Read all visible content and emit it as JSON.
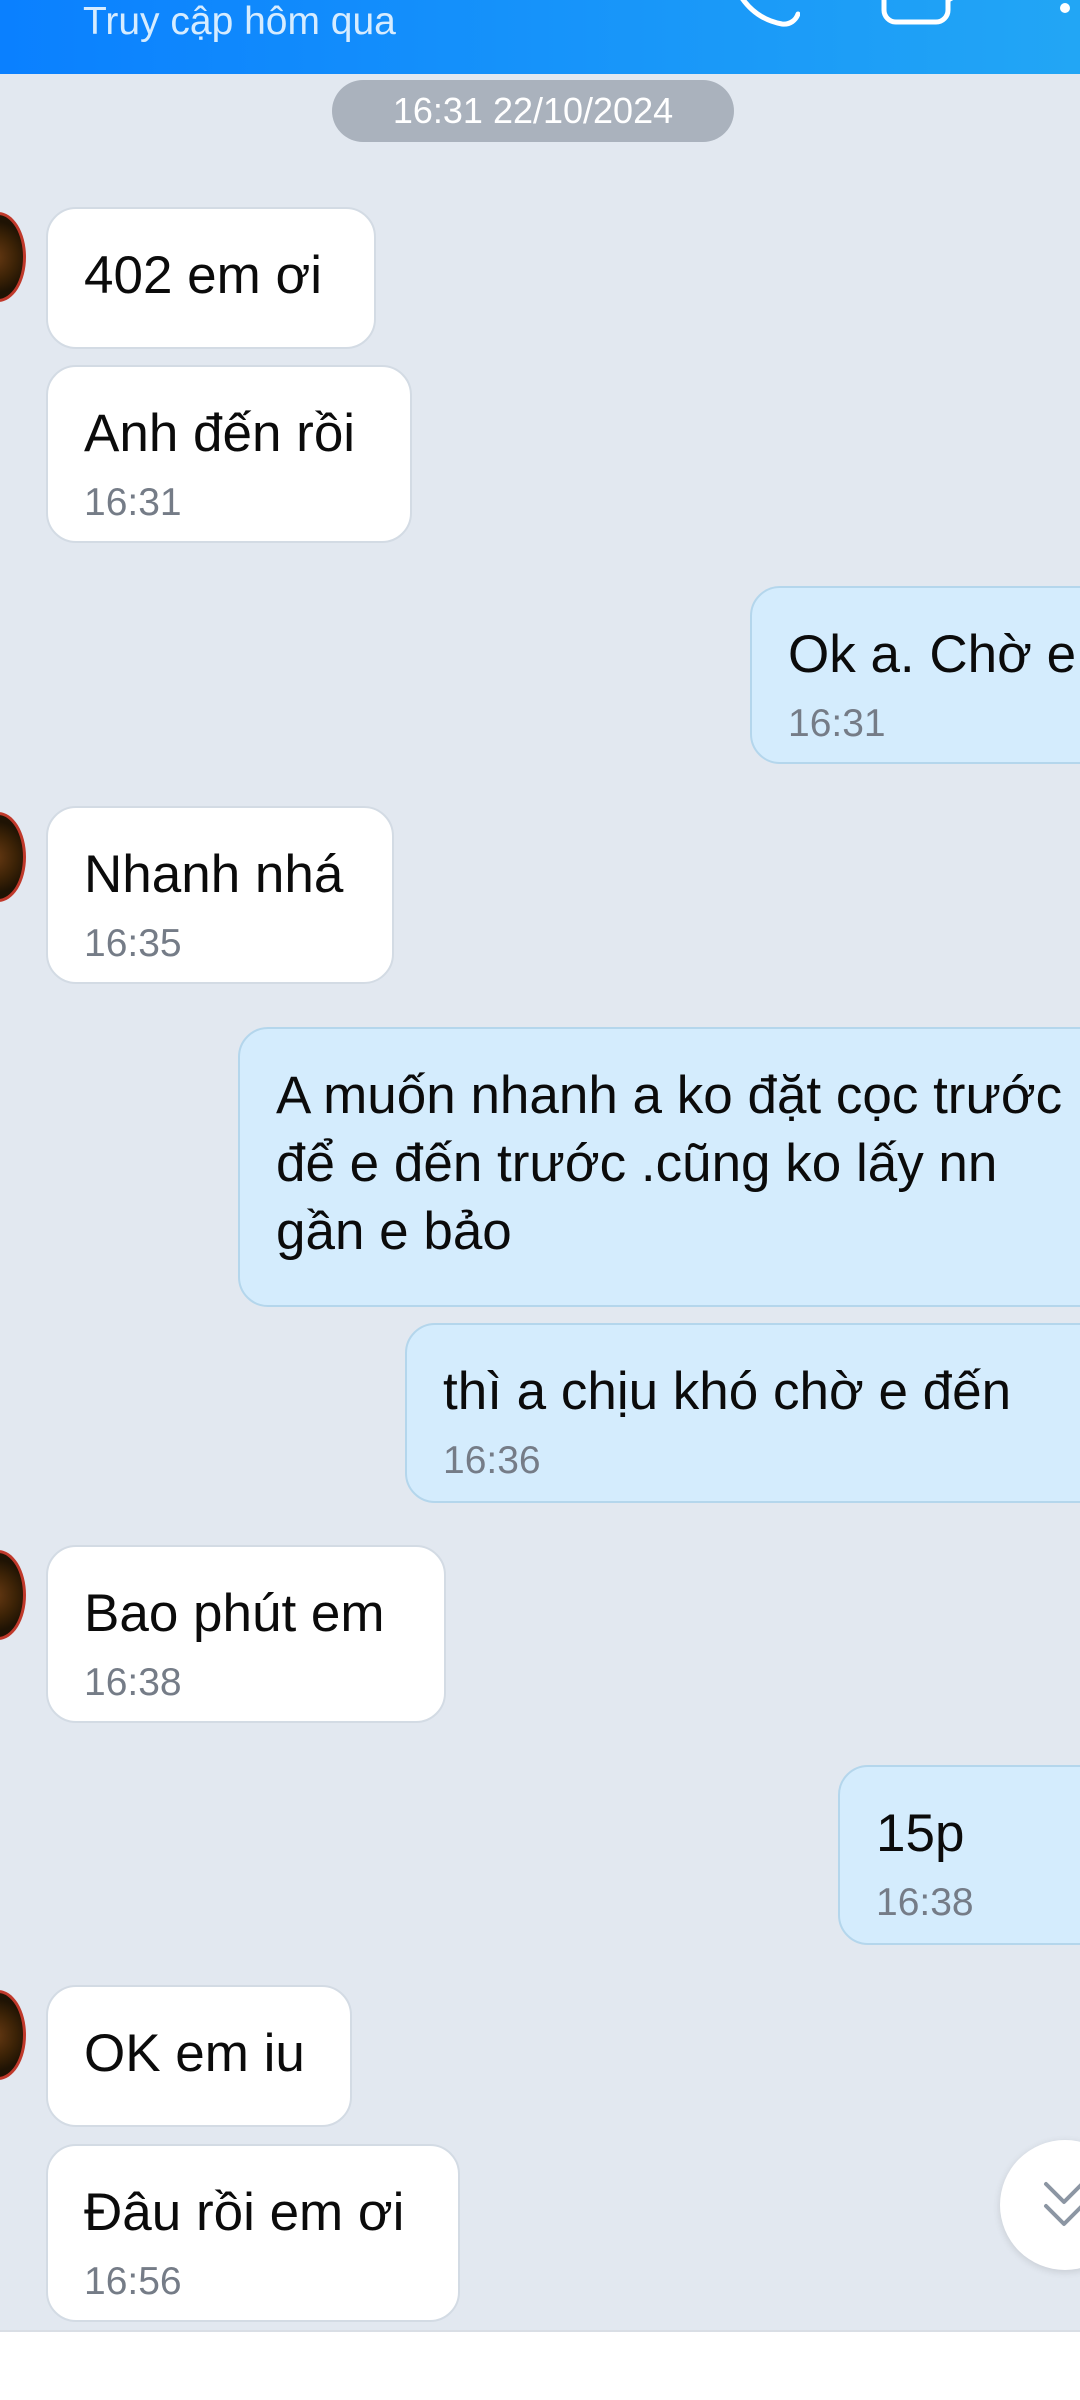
{
  "header": {
    "subtitle": "Truy cập hôm qua",
    "icons": [
      "phone-call-icon",
      "video-call-icon"
    ]
  },
  "date_separator": "16:31 22/10/2024",
  "messages": [
    {
      "side": "in",
      "text": "402 em ơi",
      "time": ""
    },
    {
      "side": "in",
      "text": "Anh đến rồi",
      "time": "16:31"
    },
    {
      "side": "out",
      "text": "Ok a. Chờ e",
      "time": "16:31"
    },
    {
      "side": "in",
      "text": "Nhanh nhá",
      "time": "16:35"
    },
    {
      "side": "out",
      "text": "A muốn  nhanh a ko đặt cọc trước để  e đến trước  .cũng  ko lấy  nn gần  e bảo",
      "time": ""
    },
    {
      "side": "out",
      "text": "thì  a chịu khó  chờ  e đến",
      "time": "16:36"
    },
    {
      "side": "in",
      "text": "Bao phút em",
      "time": "16:38"
    },
    {
      "side": "out",
      "text": "15p",
      "time": "16:38"
    },
    {
      "side": "in",
      "text": "OK em iu",
      "time": ""
    },
    {
      "side": "in",
      "text": "Đâu rồi em ơi",
      "time": "16:56"
    }
  ],
  "scroll_button": {
    "icon": "chevron-double-down-icon"
  },
  "colors": {
    "header_start": "#0a80ff",
    "header_end": "#22a6f5",
    "chat_background": "#e2e8f0",
    "incoming_bubble": "#ffffff",
    "outgoing_bubble": "#d4ecfd",
    "timestamp": "#757c87"
  }
}
